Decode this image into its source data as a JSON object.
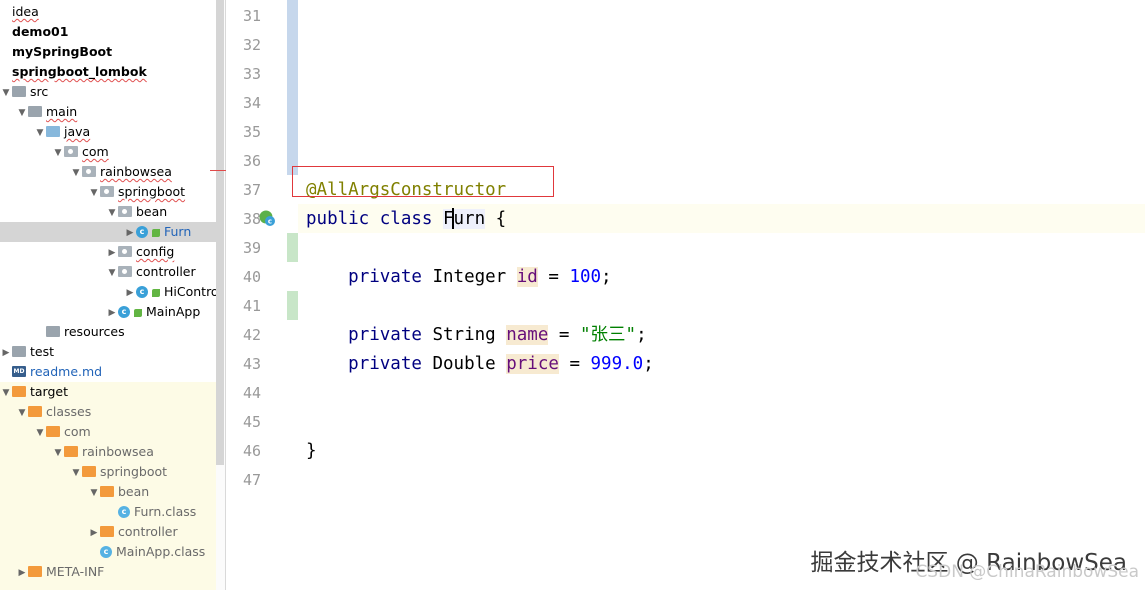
{
  "project_tree": {
    "items": [
      {
        "label": "idea",
        "indent": 0,
        "icon": "none",
        "arrow": "",
        "style": "under"
      },
      {
        "label": "demo01",
        "indent": 0,
        "icon": "none",
        "arrow": "",
        "style": "bold"
      },
      {
        "label": "mySpringBoot",
        "indent": 0,
        "icon": "none",
        "arrow": "",
        "style": "bold"
      },
      {
        "label": "springboot_lombok",
        "indent": 0,
        "icon": "none",
        "arrow": "",
        "style": "bold under"
      },
      {
        "label": "src",
        "indent": 0,
        "icon": "fold-grey",
        "arrow": "▼",
        "style": ""
      },
      {
        "label": "main",
        "indent": 1,
        "icon": "fold-grey",
        "arrow": "▼",
        "style": "under"
      },
      {
        "label": "java",
        "indent": 2,
        "icon": "fold-blue",
        "arrow": "▼",
        "style": "under"
      },
      {
        "label": "com",
        "indent": 3,
        "icon": "pkg",
        "arrow": "▼",
        "style": "under"
      },
      {
        "label": "rainbowsea",
        "indent": 4,
        "icon": "pkg",
        "arrow": "▼",
        "style": "under"
      },
      {
        "label": "springboot",
        "indent": 5,
        "icon": "pkg",
        "arrow": "▼",
        "style": "under"
      },
      {
        "label": "bean",
        "indent": 6,
        "icon": "pkg",
        "arrow": "▼",
        "style": ""
      },
      {
        "label": "Furn",
        "indent": 7,
        "icon": "cls",
        "arrow": "▶",
        "style": "link",
        "selected": true
      },
      {
        "label": "config",
        "indent": 6,
        "icon": "pkg",
        "arrow": "▶",
        "style": "under"
      },
      {
        "label": "controller",
        "indent": 6,
        "icon": "pkg",
        "arrow": "▼",
        "style": ""
      },
      {
        "label": "HiControlle",
        "indent": 7,
        "icon": "cls",
        "arrow": "▶",
        "style": ""
      },
      {
        "label": "MainApp",
        "indent": 6,
        "icon": "cls",
        "arrow": "▶",
        "style": ""
      },
      {
        "label": "resources",
        "indent": 2,
        "icon": "fold-grey",
        "arrow": "",
        "style": ""
      },
      {
        "label": "test",
        "indent": 0,
        "icon": "fold-grey",
        "arrow": "▶",
        "style": ""
      },
      {
        "label": "readme.md",
        "indent": 0,
        "icon": "mdic",
        "arrow": "",
        "style": "link"
      },
      {
        "label": "target",
        "indent": 0,
        "icon": "fold-orange",
        "arrow": "▼",
        "style": ""
      },
      {
        "label": "classes",
        "indent": 1,
        "icon": "fold-orange",
        "arrow": "▼",
        "style": "greytxt"
      },
      {
        "label": "com",
        "indent": 2,
        "icon": "fold-orange",
        "arrow": "▼",
        "style": "greytxt"
      },
      {
        "label": "rainbowsea",
        "indent": 3,
        "icon": "fold-orange",
        "arrow": "▼",
        "style": "greytxt"
      },
      {
        "label": "springboot",
        "indent": 4,
        "icon": "fold-orange",
        "arrow": "▼",
        "style": "greytxt"
      },
      {
        "label": "bean",
        "indent": 5,
        "icon": "fold-orange",
        "arrow": "▼",
        "style": "greytxt"
      },
      {
        "label": "Furn.class",
        "indent": 6,
        "icon": "cls ghost",
        "arrow": "",
        "style": "greytxt"
      },
      {
        "label": "controller",
        "indent": 5,
        "icon": "fold-orange",
        "arrow": "▶",
        "style": "greytxt"
      },
      {
        "label": "MainApp.class",
        "indent": 5,
        "icon": "cls ghost",
        "arrow": "",
        "style": "greytxt"
      },
      {
        "label": "META-INF",
        "indent": 1,
        "icon": "fold-orange",
        "arrow": "▶",
        "style": "greytxt"
      }
    ]
  },
  "gutter": {
    "line_numbers": [
      "31",
      "32",
      "33",
      "34",
      "35",
      "36",
      "37",
      "38",
      "39",
      "40",
      "41",
      "42",
      "43",
      "44",
      "45",
      "46",
      "47"
    ]
  },
  "editor": {
    "lines": [
      {
        "n": 37,
        "html": "<span class='anno'>@AllArgsConstructor</span>"
      },
      {
        "n": 38,
        "html": "<span class='kw'>public class</span> <span class='ident'>Furn</span> {"
      },
      {
        "n": 40,
        "html": "    <span class='kw'>private</span> Integer <span class='fld'>id</span> = <span class='num'>100</span>;"
      },
      {
        "n": 42,
        "html": "    <span class='kw'>private</span> String <span class='fld'>name</span> = <span class='str'>\"张三\"</span>;"
      },
      {
        "n": 43,
        "html": "    <span class='kw'>private</span> Double <span class='fld'>price</span> = <span class='num'>999.0</span>;"
      },
      {
        "n": 46,
        "html": "}"
      }
    ]
  },
  "watermark": {
    "text": "掘金技术社区 @ RainbowSea",
    "sub": "CSDN @ChinaRainbowSea"
  },
  "colors": {
    "keyword": "#000080",
    "annotation": "#808000",
    "field": "#660e7a",
    "number": "#0000ff",
    "string": "#008000",
    "highlight_box": "#e0383c"
  }
}
